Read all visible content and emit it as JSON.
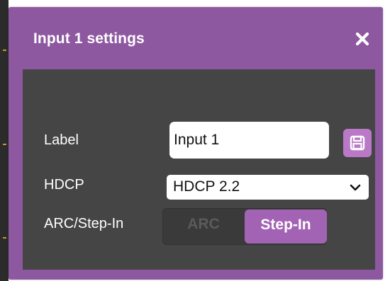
{
  "dialog": {
    "title": "Input 1 settings",
    "close_icon": "close-icon"
  },
  "fields": {
    "label": {
      "label": "Label",
      "value": "Input 1",
      "save_icon": "save-icon"
    },
    "hdcp": {
      "label": "HDCP",
      "selected": "HDCP 2.2",
      "chevron_icon": "chevron-down-icon"
    },
    "arc": {
      "label": "ARC/Step-In",
      "options": [
        "ARC",
        "Step-In"
      ],
      "selected": "Step-In"
    }
  },
  "colors": {
    "dialog_bg": "#8e58a0",
    "body_bg": "#454545",
    "accent": "#a363b4",
    "save_button": "#b979c6"
  }
}
